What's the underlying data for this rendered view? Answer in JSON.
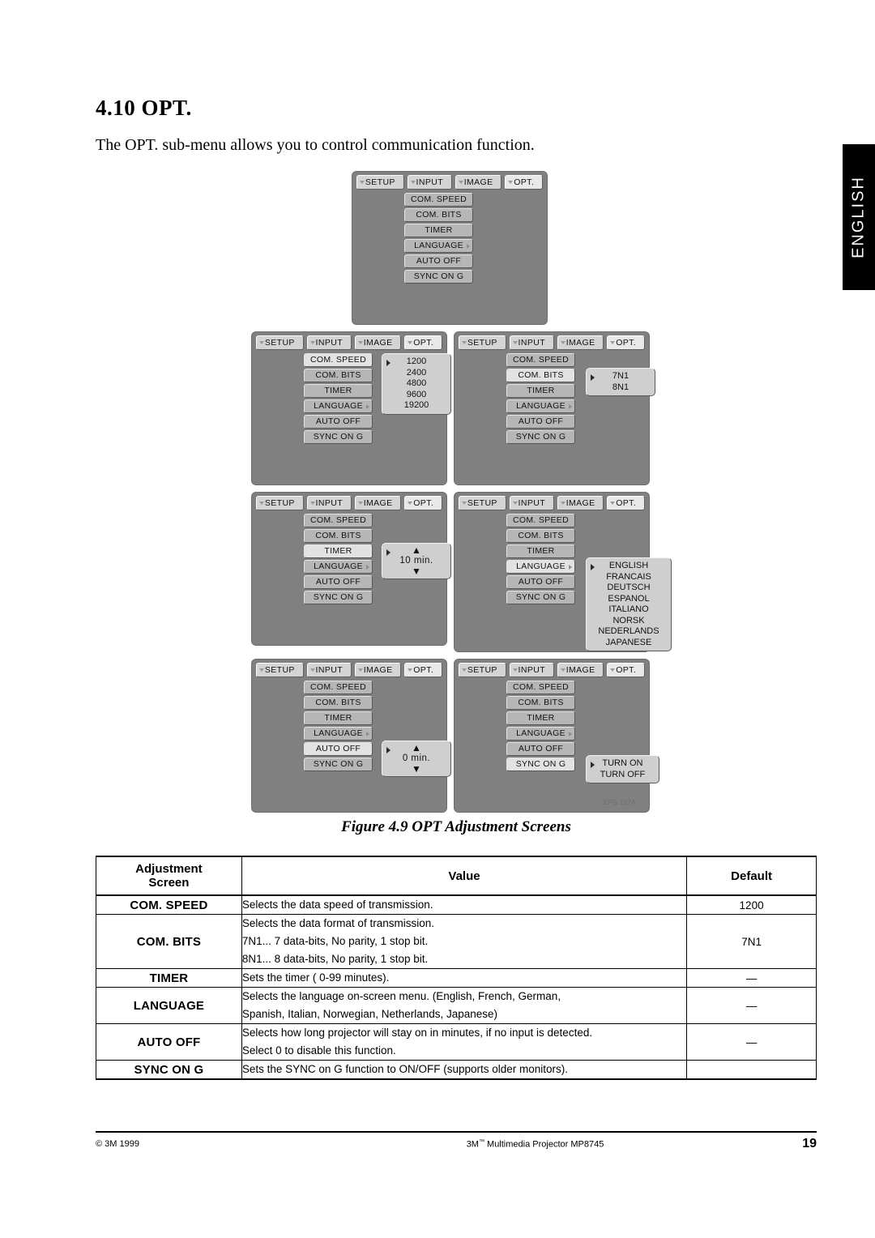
{
  "side_tab": {
    "label": "ENGLISH"
  },
  "heading": {
    "number_title": "4.10 OPT.",
    "intro": "The OPT. sub-menu allows you to control communication function."
  },
  "figure": {
    "caption": "Figure 4.9 OPT Adjustment Screens",
    "eps_label": "EPS-137A",
    "tabs": [
      "SETUP",
      "INPUT",
      "IMAGE",
      "OPT."
    ],
    "active_tab": "OPT.",
    "menu_items": [
      "COM. SPEED",
      "COM. BITS",
      "TIMER",
      "LANGUAGE",
      "AUTO OFF",
      "SYNC ON G"
    ],
    "screens": [
      {
        "name": "main-menu",
        "selected": null,
        "popup": null
      },
      {
        "name": "com-speed",
        "selected": "COM. SPEED",
        "popup": {
          "type": "list",
          "items": [
            "1200",
            "2400",
            "4800",
            "9600",
            "19200"
          ]
        }
      },
      {
        "name": "com-bits",
        "selected": "COM. BITS",
        "popup": {
          "type": "list",
          "items": [
            "7N1",
            "8N1"
          ]
        }
      },
      {
        "name": "timer",
        "selected": "TIMER",
        "popup": {
          "type": "spinner",
          "value": "10 min."
        }
      },
      {
        "name": "language",
        "selected": "LANGUAGE",
        "popup": {
          "type": "list",
          "items": [
            "ENGLISH",
            "FRANCAIS",
            "DEUTSCH",
            "ESPANOL",
            "ITALIANO",
            "NORSK",
            "NEDERLANDS",
            "JAPANESE"
          ]
        }
      },
      {
        "name": "auto-off",
        "selected": "AUTO OFF",
        "popup": {
          "type": "spinner",
          "value": "0 min."
        }
      },
      {
        "name": "sync-on-g",
        "selected": "SYNC ON G",
        "popup": {
          "type": "list",
          "items": [
            "TURN ON",
            "TURN OFF"
          ]
        }
      }
    ],
    "spinner_up_glyph": "▲",
    "spinner_down_glyph": "▼"
  },
  "table": {
    "headers": {
      "adjustment": "Adjustment",
      "adjustment_line2": "Screen",
      "value": "Value",
      "default": "Default"
    },
    "rows": [
      {
        "adjustment": "COM. SPEED",
        "value_lines": [
          "Selects the data speed of transmission."
        ],
        "default": "1200"
      },
      {
        "adjustment": "COM. BITS",
        "value_lines": [
          "Selects the data format of transmission.",
          "7N1... 7 data-bits, No parity, 1 stop bit.",
          "8N1... 8 data-bits, No parity, 1 stop bit."
        ],
        "default": "7N1"
      },
      {
        "adjustment": "TIMER",
        "value_lines": [
          "Sets the timer ( 0-99 minutes)."
        ],
        "default": "—"
      },
      {
        "adjustment": "LANGUAGE",
        "value_lines": [
          "Selects the language on-screen menu. (English, French, German,",
          "Spanish, Italian, Norwegian, Netherlands, Japanese)"
        ],
        "default": "—"
      },
      {
        "adjustment": "AUTO OFF",
        "value_lines": [
          "Selects how long projector will stay on in minutes, if no input is detected.",
          "Select 0 to disable this function."
        ],
        "default": "—"
      },
      {
        "adjustment": "SYNC ON G",
        "value_lines": [
          "Sets the SYNC on G function to ON/OFF (supports older monitors)."
        ],
        "default": ""
      }
    ]
  },
  "footer": {
    "copyright": "© 3M 1999",
    "center_pre": "3M",
    "center_sup": "™",
    "center_post": " Multimedia Projector MP8745",
    "page_number": "19"
  }
}
